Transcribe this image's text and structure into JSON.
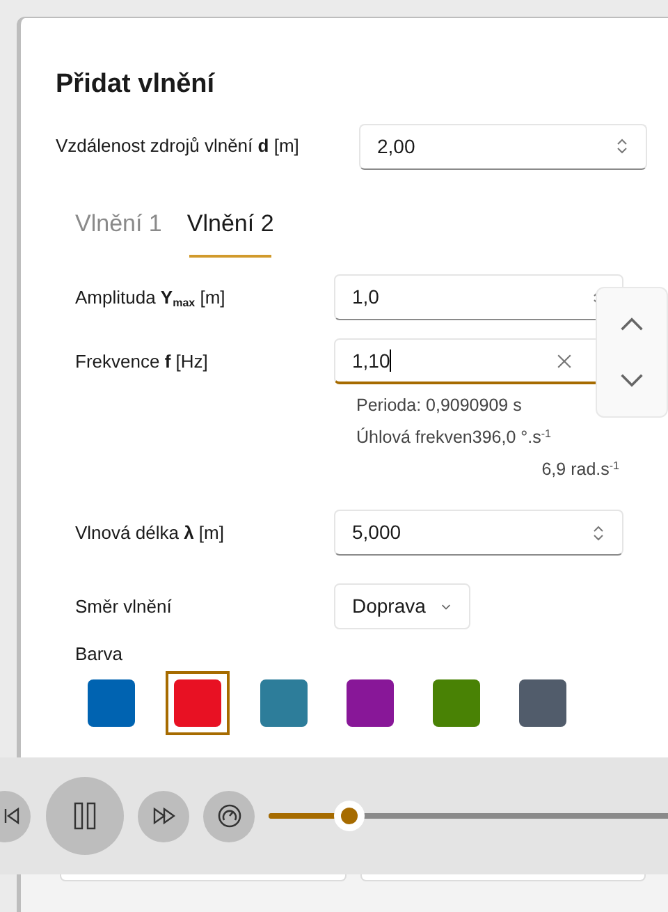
{
  "dialog": {
    "title": "Přidat vlnění"
  },
  "distance": {
    "label": "Vzdálenost zdrojů vlnění **d** [m]",
    "value": "2,00"
  },
  "tabs": [
    {
      "label": "Vlnění 1",
      "selected": false
    },
    {
      "label": "Vlnění 2",
      "selected": true
    }
  ],
  "amplitude": {
    "label": "Amplituda **Y**$_{max}$ [m]",
    "value": "1,0"
  },
  "frequency": {
    "label": "Frekvence **f** [Hz]",
    "value": "1,10",
    "focused": true,
    "info": [
      "Perioda: 0,9090909 s",
      "Úhlová frekven396,0 °.s$^{-1}$",
      "6,9 rad.s$^{-1}$"
    ]
  },
  "wavelength": {
    "label": "Vlnová délka **λ** [m]",
    "value": "5,000"
  },
  "direction": {
    "label": "Směr vlnění",
    "value": "Doprava"
  },
  "color_picker": {
    "label": "Barva",
    "swatches": [
      {
        "color": "#0063b1",
        "selected": false
      },
      {
        "color": "#e81123",
        "selected": true
      },
      {
        "color": "#2d7d9a",
        "selected": false
      },
      {
        "color": "#881798",
        "selected": false
      },
      {
        "color": "#498205",
        "selected": false
      },
      {
        "color": "#515c6b",
        "selected": false
      }
    ]
  },
  "player": {
    "playing": true,
    "progress": {
      "level": 0.19
    }
  }
}
